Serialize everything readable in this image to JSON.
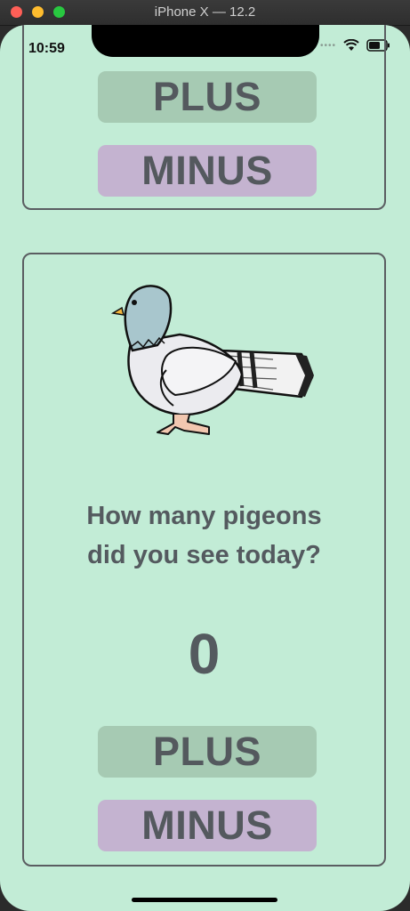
{
  "window": {
    "title": "iPhone X — 12.2"
  },
  "status_bar": {
    "time": "10:59"
  },
  "top_card": {
    "plus_label": "PLUS",
    "minus_label": "MINUS"
  },
  "main_card": {
    "question_line1": "How many pigeons",
    "question_line2": "did you see today?",
    "count": "0",
    "plus_label": "PLUS",
    "minus_label": "MINUS"
  },
  "colors": {
    "background": "#c2ecd6",
    "plus_button": "#a6cab3",
    "minus_button": "#c4b3d0",
    "text": "#545a5f"
  }
}
